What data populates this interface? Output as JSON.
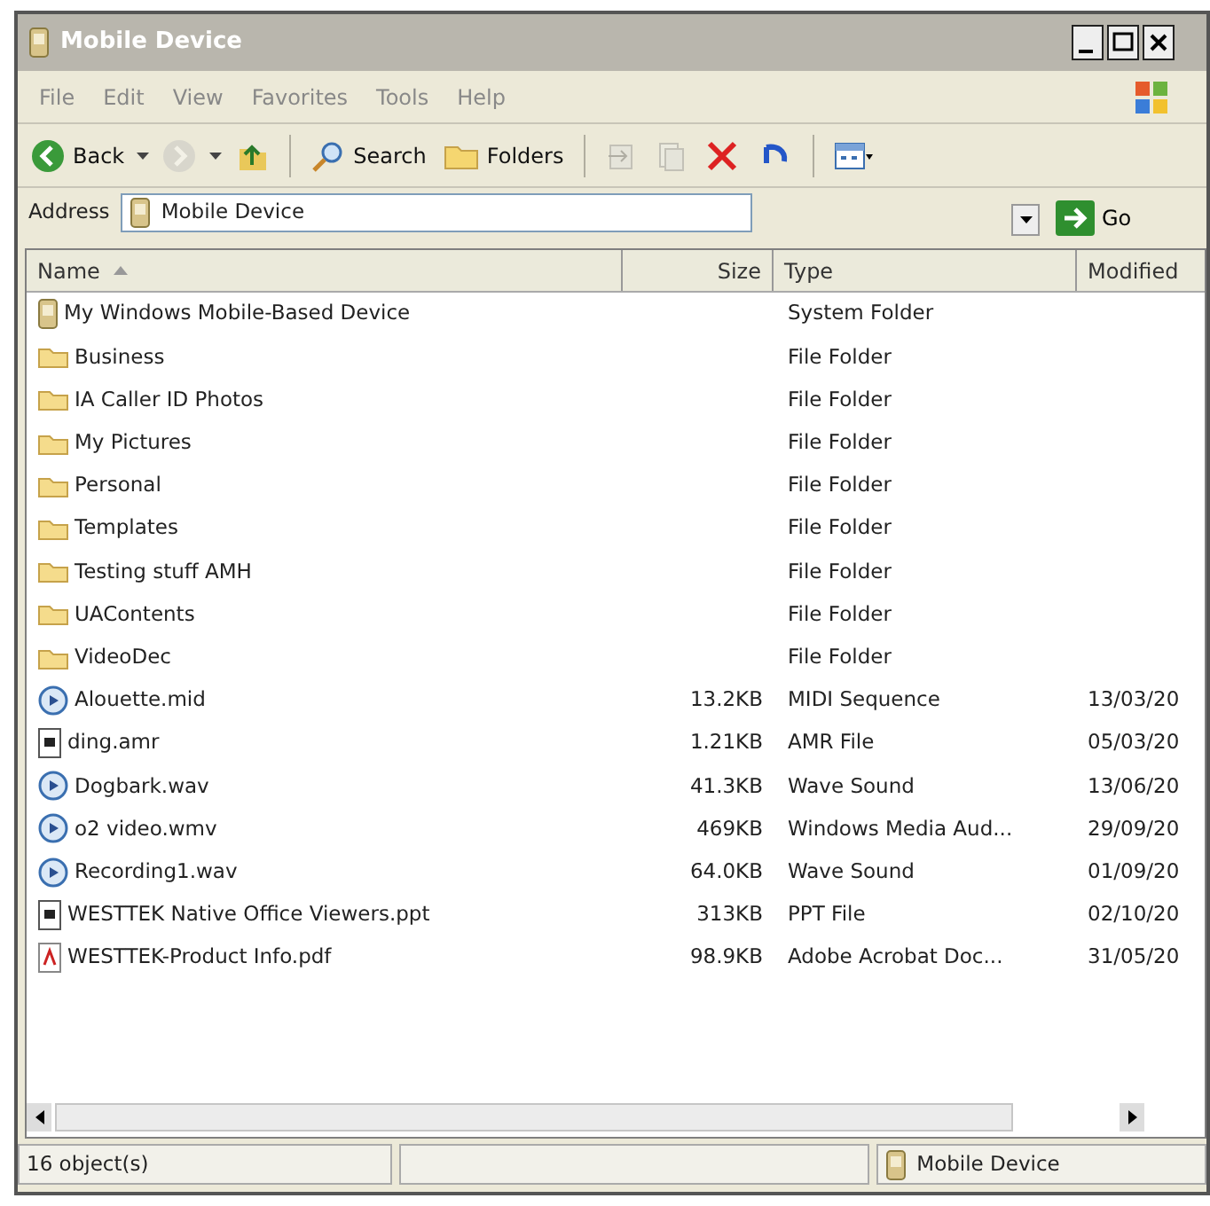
{
  "window": {
    "title": "Mobile Device",
    "active": false
  },
  "menu": [
    {
      "label": "File"
    },
    {
      "label": "Edit"
    },
    {
      "label": "View"
    },
    {
      "label": "Favorites"
    },
    {
      "label": "Tools"
    },
    {
      "label": "Help"
    }
  ],
  "toolbar": [
    {
      "kind": "back",
      "label": "Back",
      "disabled": false
    },
    {
      "kind": "forward",
      "disabled": true
    },
    {
      "kind": "up",
      "disabled": false
    },
    {
      "kind": "separator"
    },
    {
      "kind": "search",
      "label": "Search",
      "disabled": false
    },
    {
      "kind": "folders",
      "label": "Folders",
      "disabled": false
    },
    {
      "kind": "separator"
    },
    {
      "kind": "move",
      "disabled": true
    },
    {
      "kind": "copy",
      "disabled": true
    },
    {
      "kind": "delete",
      "disabled": false
    },
    {
      "kind": "undo",
      "disabled": false
    },
    {
      "kind": "separator"
    },
    {
      "kind": "views",
      "disabled": false
    }
  ],
  "address": {
    "label": "Address",
    "value": "Mobile Device",
    "go": "Go"
  },
  "columns": [
    {
      "label": "Name",
      "sorted": true
    },
    {
      "label": "Size",
      "sorted": false
    },
    {
      "label": "Type",
      "sorted": false
    },
    {
      "label": "Modified",
      "sorted": false
    }
  ],
  "rows": [
    {
      "kind": "device",
      "name": "My Windows Mobile-Based Device",
      "type": "System Folder"
    },
    {
      "kind": "folder",
      "name": "Business",
      "type": "File Folder"
    },
    {
      "kind": "folder",
      "name": "IA Caller ID Photos",
      "type": "File Folder"
    },
    {
      "kind": "folder",
      "name": "My Pictures",
      "type": "File Folder"
    },
    {
      "kind": "folder",
      "name": "Personal",
      "type": "File Folder"
    },
    {
      "kind": "folder",
      "name": "Templates",
      "type": "File Folder"
    },
    {
      "kind": "folder",
      "name": "Testing stuff AMH",
      "type": "File Folder"
    },
    {
      "kind": "folder",
      "name": "UAContents",
      "type": "File Folder"
    },
    {
      "kind": "folder",
      "name": "VideoDec",
      "type": "File Folder"
    },
    {
      "kind": "media",
      "name": "Alouette.mid",
      "size": "13.2KB",
      "type": "MIDI Sequence",
      "modified": "13/03/20"
    },
    {
      "kind": "file",
      "name": "ding.amr",
      "size": "1.21KB",
      "type": "AMR File",
      "modified": "05/03/20"
    },
    {
      "kind": "media",
      "name": "Dogbark.wav",
      "size": "41.3KB",
      "type": "Wave Sound",
      "modified": "13/06/20"
    },
    {
      "kind": "media",
      "name": "o2 video.wmv",
      "size": "469KB",
      "type": "Windows Media Aud...",
      "modified": "29/09/20"
    },
    {
      "kind": "media",
      "name": "Recording1.wav",
      "size": "64.0KB",
      "type": "Wave Sound",
      "modified": "01/09/20"
    },
    {
      "kind": "file",
      "name": "WESTTEK Native Office Viewers.ppt",
      "size": "313KB",
      "type": "PPT File",
      "modified": "02/10/20"
    },
    {
      "kind": "pdf",
      "name": "WESTTEK-Product Info.pdf",
      "size": "98.9KB",
      "type": "Adobe Acrobat Doc...",
      "modified": "31/05/20"
    }
  ],
  "status_bar": {
    "count": "16 object(s)",
    "zone": "Mobile Device"
  }
}
